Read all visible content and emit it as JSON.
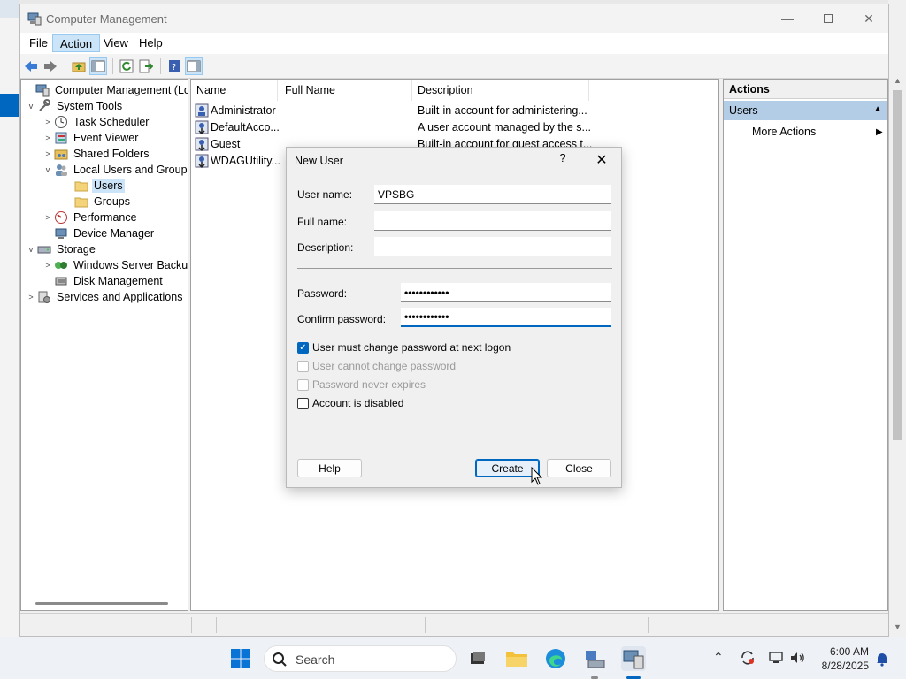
{
  "window": {
    "title": "Computer Management",
    "controls": [
      "minimize",
      "maximize",
      "close"
    ]
  },
  "menu": {
    "items": [
      "File",
      "Action",
      "View",
      "Help"
    ],
    "active": "Action"
  },
  "toolbar": {
    "icons": [
      "back-icon",
      "forward-icon",
      "up-folder-icon",
      "show-hide-tree-icon",
      "refresh-icon",
      "export-list-icon",
      "help-icon",
      "show-hide-action-pane-icon"
    ]
  },
  "tree": {
    "items": [
      {
        "label": "Computer Management (Local",
        "icon": "computer-management-icon",
        "expander": "",
        "level": 0
      },
      {
        "label": "System Tools",
        "icon": "system-tools-icon",
        "expander": "v",
        "level": 1
      },
      {
        "label": "Task Scheduler",
        "icon": "clock-icon",
        "expander": ">",
        "level": 2
      },
      {
        "label": "Event Viewer",
        "icon": "event-viewer-icon",
        "expander": ">",
        "level": 2
      },
      {
        "label": "Shared Folders",
        "icon": "shared-folder-icon",
        "expander": ">",
        "level": 2
      },
      {
        "label": "Local Users and Groups",
        "icon": "users-groups-icon",
        "expander": "v",
        "level": 2
      },
      {
        "label": "Users",
        "icon": "folder-icon",
        "expander": "",
        "level": 3,
        "selected": true
      },
      {
        "label": "Groups",
        "icon": "folder-icon",
        "expander": "",
        "level": 3
      },
      {
        "label": "Performance",
        "icon": "performance-icon",
        "expander": ">",
        "level": 2
      },
      {
        "label": "Device Manager",
        "icon": "device-manager-icon",
        "expander": "",
        "level": 2
      },
      {
        "label": "Storage",
        "icon": "storage-icon",
        "expander": "v",
        "level": 1
      },
      {
        "label": "Windows Server Backup",
        "icon": "backup-icon",
        "expander": ">",
        "level": 2
      },
      {
        "label": "Disk Management",
        "icon": "disk-icon",
        "expander": "",
        "level": 2
      },
      {
        "label": "Services and Applications",
        "icon": "services-icon",
        "expander": ">",
        "level": 1
      }
    ]
  },
  "list": {
    "columns": [
      "Name",
      "Full Name",
      "Description"
    ],
    "rows": [
      {
        "name": "Administrator",
        "full_name": "",
        "description": "Built-in account for administering..."
      },
      {
        "name": "DefaultAcco...",
        "full_name": "",
        "description": "A user account managed by the s..."
      },
      {
        "name": "Guest",
        "full_name": "",
        "description": "Built-in account for guest access t..."
      },
      {
        "name": "WDAGUtility...",
        "full_name": "",
        "description": ""
      }
    ]
  },
  "actions": {
    "header": "Actions",
    "section": "Users",
    "items": [
      "More Actions"
    ]
  },
  "dialog": {
    "title": "New User",
    "help_glyph": "?",
    "close_glyph": "✕",
    "fields": {
      "username_label": "User name:",
      "username_value": "VPSBG",
      "fullname_label": "Full name:",
      "fullname_value": "",
      "description_label": "Description:",
      "description_value": "",
      "password_label": "Password:",
      "password_value": "••••••••••••",
      "confirm_label": "Confirm password:",
      "confirm_value": "••••••••••••"
    },
    "checkboxes": [
      {
        "label": "User must change password at next logon",
        "checked": true,
        "disabled": false
      },
      {
        "label": "User cannot change password",
        "checked": false,
        "disabled": true
      },
      {
        "label": "Password never expires",
        "checked": false,
        "disabled": true
      },
      {
        "label": "Account is disabled",
        "checked": false,
        "disabled": false
      }
    ],
    "buttons": {
      "help": "Help",
      "create": "Create",
      "close": "Close"
    }
  },
  "taskbar": {
    "search_placeholder": "Search",
    "apps": [
      "start-icon",
      "search-icon",
      "task-view-icon",
      "file-explorer-icon",
      "edge-icon",
      "server-manager-icon",
      "computer-management-icon"
    ],
    "tray": [
      "chevron-up-icon",
      "sync-icon",
      "network-icon",
      "volume-icon"
    ],
    "time": "6:00 AM",
    "date": "8/28/2025",
    "notification_icon": "bell-icon"
  },
  "colors": {
    "selection": "#cce4f7",
    "accent": "#0067c0",
    "actions_section": "#b3cde6"
  }
}
